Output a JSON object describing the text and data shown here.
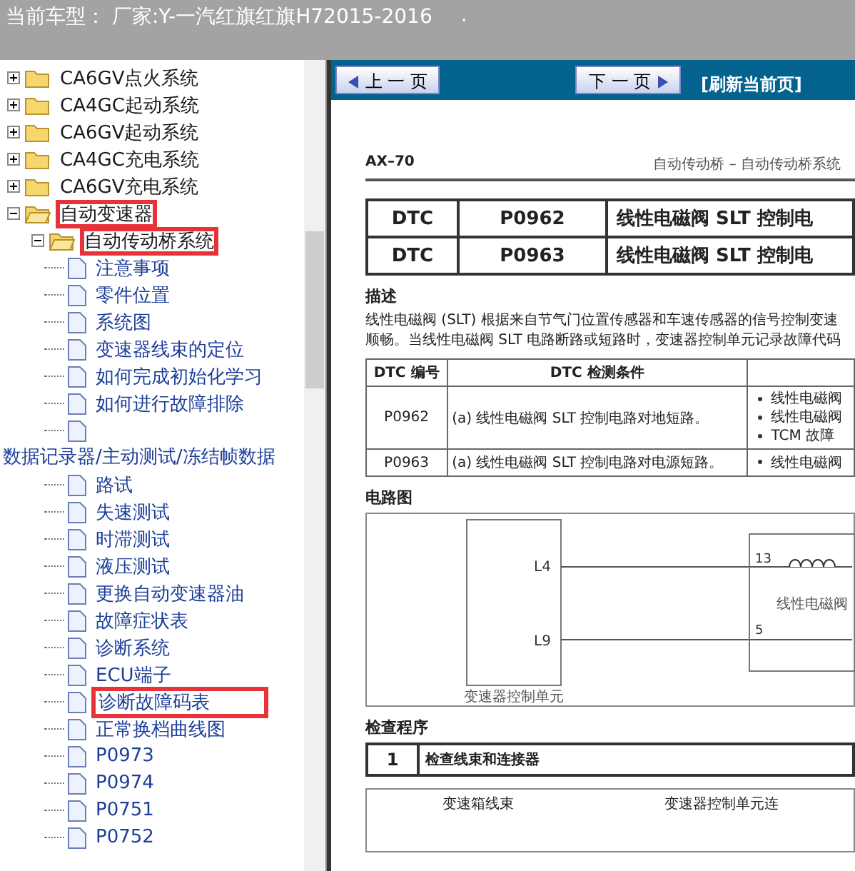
{
  "header": {
    "vehicle": "当前车型： 厂家:Y-一汽红旗红旗H72015-2016",
    "mark": "."
  },
  "tree": [
    {
      "kind": "folder",
      "label": "CA6GV点火系统",
      "expanded": false,
      "highlighted": false
    },
    {
      "kind": "folder",
      "label": "CA4GC起动系统",
      "expanded": false,
      "highlighted": false
    },
    {
      "kind": "folder",
      "label": "CA6GV起动系统",
      "expanded": false,
      "highlighted": false
    },
    {
      "kind": "folder",
      "label": "CA4GC充电系统",
      "expanded": false,
      "highlighted": false
    },
    {
      "kind": "folder",
      "label": "CA6GV充电系统",
      "expanded": false,
      "highlighted": false
    },
    {
      "kind": "folder",
      "label": "自动变速器",
      "expanded": true,
      "highlighted": true,
      "children": [
        {
          "kind": "folder",
          "label": "自动传动桥系统",
          "expanded": true,
          "highlighted": true,
          "children": [
            {
              "kind": "page",
              "label": "注意事项",
              "highlighted": false
            },
            {
              "kind": "page",
              "label": "零件位置",
              "highlighted": false
            },
            {
              "kind": "page",
              "label": "系统图",
              "highlighted": false
            },
            {
              "kind": "page",
              "label": "变速器线束的定位",
              "highlighted": false
            },
            {
              "kind": "page",
              "label": "如何完成初始化学习",
              "highlighted": false
            },
            {
              "kind": "page",
              "label": "如何进行故障排除",
              "highlighted": false
            },
            {
              "kind": "wrapped",
              "label": "数据记录器/主动测试/冻结帧数据",
              "highlighted": false
            },
            {
              "kind": "page",
              "label": "路试",
              "highlighted": false
            },
            {
              "kind": "page",
              "label": "失速测试",
              "highlighted": false
            },
            {
              "kind": "page",
              "label": "时滞测试",
              "highlighted": false
            },
            {
              "kind": "page",
              "label": "液压测试",
              "highlighted": false
            },
            {
              "kind": "page",
              "label": "更换自动变速器油",
              "highlighted": false
            },
            {
              "kind": "page",
              "label": "故障症状表",
              "highlighted": false
            },
            {
              "kind": "page",
              "label": "诊断系统",
              "highlighted": false
            },
            {
              "kind": "page",
              "label": "ECU端子",
              "highlighted": false
            },
            {
              "kind": "page",
              "label": "诊断故障码表",
              "highlighted": true
            },
            {
              "kind": "page",
              "label": "正常换档曲线图",
              "highlighted": false
            },
            {
              "kind": "page",
              "label": "P0973",
              "highlighted": false
            },
            {
              "kind": "page",
              "label": "P0974",
              "highlighted": false
            },
            {
              "kind": "page",
              "label": "P0751",
              "highlighted": false
            },
            {
              "kind": "page",
              "label": "P0752",
              "highlighted": false
            }
          ]
        }
      ]
    }
  ],
  "nav": {
    "prev": "上 一 页",
    "next": "下 一 页",
    "refresh": "[刷新当前页]"
  },
  "document": {
    "code": "AX–70",
    "title": "自动传动桥 – 自动传动桥系统",
    "dtc_rows": [
      {
        "label": "DTC",
        "code": "P0962",
        "name": "线性电磁阀 SLT 控制电"
      },
      {
        "label": "DTC",
        "code": "P0963",
        "name": "线性电磁阀 SLT 控制电"
      }
    ],
    "description_heading": "描述",
    "description": [
      "线性电磁阀 (SLT) 根据来自节气门位置传感器和车速传感器的信号控制变速",
      "顺畅。当线性电磁阀 SLT 电路断路或短路时，变速器控制单元记录故障代码"
    ],
    "detection_table": {
      "columns": [
        "DTC 编号",
        "DTC 检测条件"
      ],
      "rows": [
        {
          "code": "P0962",
          "condition": "(a) 线性电磁阀 SLT 控制电路对地短路。",
          "causes": [
            "线性电磁阀",
            "线性电磁阀",
            "TCM 故障"
          ]
        },
        {
          "code": "P0963",
          "condition": "(a) 线性电磁阀 SLT 控制电路对电源短路。",
          "causes": [
            "线性电磁阀"
          ]
        }
      ]
    },
    "circuit_heading": "电路图",
    "circuit": {
      "unit": "变速器控制单元",
      "pins": [
        "L4",
        "L9"
      ],
      "valve_pins": [
        "13",
        "5"
      ],
      "valve": "线性电磁阀"
    },
    "procedure_heading": "检查程序",
    "steps": [
      {
        "number": "1",
        "text": "检查线束和连接器"
      }
    ],
    "connector_labels": [
      "变速箱线束",
      "变速器控制单元连"
    ]
  }
}
